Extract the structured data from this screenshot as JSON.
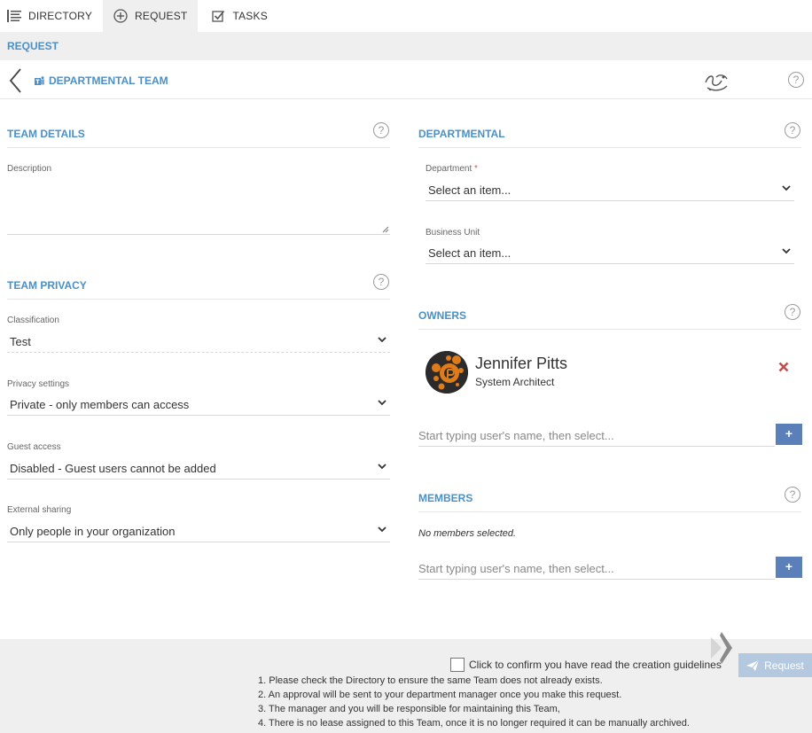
{
  "nav": {
    "tabs": [
      {
        "label": "DIRECTORY",
        "icon": "list-icon"
      },
      {
        "label": "REQUEST",
        "icon": "plus-circle-icon",
        "active": true
      },
      {
        "label": "TASKS",
        "icon": "checkbox-icon"
      }
    ]
  },
  "breadcrumb": "REQUEST",
  "page": {
    "title": "DEPARTMENTAL TEAM"
  },
  "team_details": {
    "title": "TEAM DETAILS",
    "description_label": "Description",
    "description_value": ""
  },
  "team_privacy": {
    "title": "TEAM PRIVACY",
    "classification": {
      "label": "Classification",
      "value": "Test"
    },
    "privacy": {
      "label": "Privacy settings",
      "value": "Private - only members can access"
    },
    "guest": {
      "label": "Guest access",
      "value": "Disabled - Guest users cannot be added"
    },
    "sharing": {
      "label": "External sharing",
      "value": "Only people in your organization"
    }
  },
  "departmental": {
    "title": "DEPARTMENTAL",
    "department": {
      "label": "Department",
      "required_mark": "*",
      "value": "Select an item..."
    },
    "business_unit": {
      "label": "Business Unit",
      "value": "Select an item..."
    }
  },
  "owners": {
    "title": "OWNERS",
    "list": [
      {
        "name": "Jennifer Pitts",
        "role": "System Architect"
      }
    ],
    "placeholder": "Start typing user's name, then select..."
  },
  "members": {
    "title": "MEMBERS",
    "empty_text": "No members selected.",
    "placeholder": "Start typing user's name, then select..."
  },
  "footer": {
    "confirm_label": "Click to confirm you have read the creation guidelines",
    "request_label": "Request",
    "guidelines": [
      "1. Please check the Directory to ensure the same Team does not already exists.",
      "2. An approval will be sent to your department manager once you make this request.",
      "3. The manager and you will be responsible for maintaining this Team,",
      "4. There is no lease assigned to this Team, once it is no longer required it can be manually archived."
    ]
  },
  "help_symbol": "?",
  "plus_symbol": "+",
  "colors": {
    "accent": "#4a90c8",
    "button": "#5b7fb8",
    "remove": "#c0504d",
    "request_button": "#b4c9e0"
  }
}
